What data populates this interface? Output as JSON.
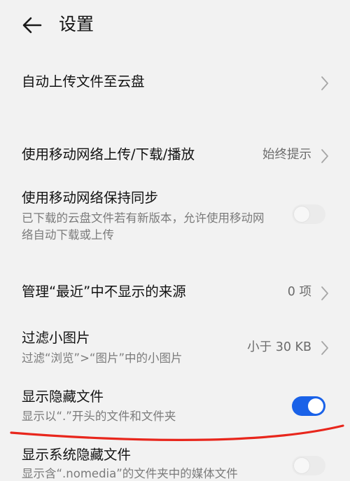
{
  "header": {
    "title": "设置"
  },
  "settings": [
    {
      "title": "自动上传文件至云盘",
      "type": "link"
    },
    {
      "title": "使用移动网络上传/下载/播放",
      "value": "始终提示",
      "type": "link"
    },
    {
      "title": "使用移动网络保持同步",
      "subtitle": "已下载的云盘文件若有新版本，允许使用移动网络自动下载或上传",
      "type": "toggle",
      "state": "off"
    },
    {
      "title": "管理“最近”中不显示的来源",
      "value": "0 项",
      "type": "link"
    },
    {
      "title": "过滤小图片",
      "subtitle": "过滤“浏览”>“图片”中的小图片",
      "value": "小于 30 KB",
      "type": "link"
    },
    {
      "title": "显示隐藏文件",
      "subtitle": "显示以“.”开头的文件和文件夹",
      "type": "toggle",
      "state": "on"
    },
    {
      "title": "显示系统隐藏文件",
      "subtitle": "显示含“.nomedia”的文件夹中的媒体文件",
      "type": "toggle",
      "state": "off"
    }
  ],
  "colors": {
    "background": "#f2f2f2",
    "accent": "#1a62e8",
    "annotation": "#e8261c",
    "subtitle_text": "#7b7b7b"
  },
  "icons": {
    "back": "arrow-left-icon",
    "chevron": "chevron-right-icon"
  }
}
